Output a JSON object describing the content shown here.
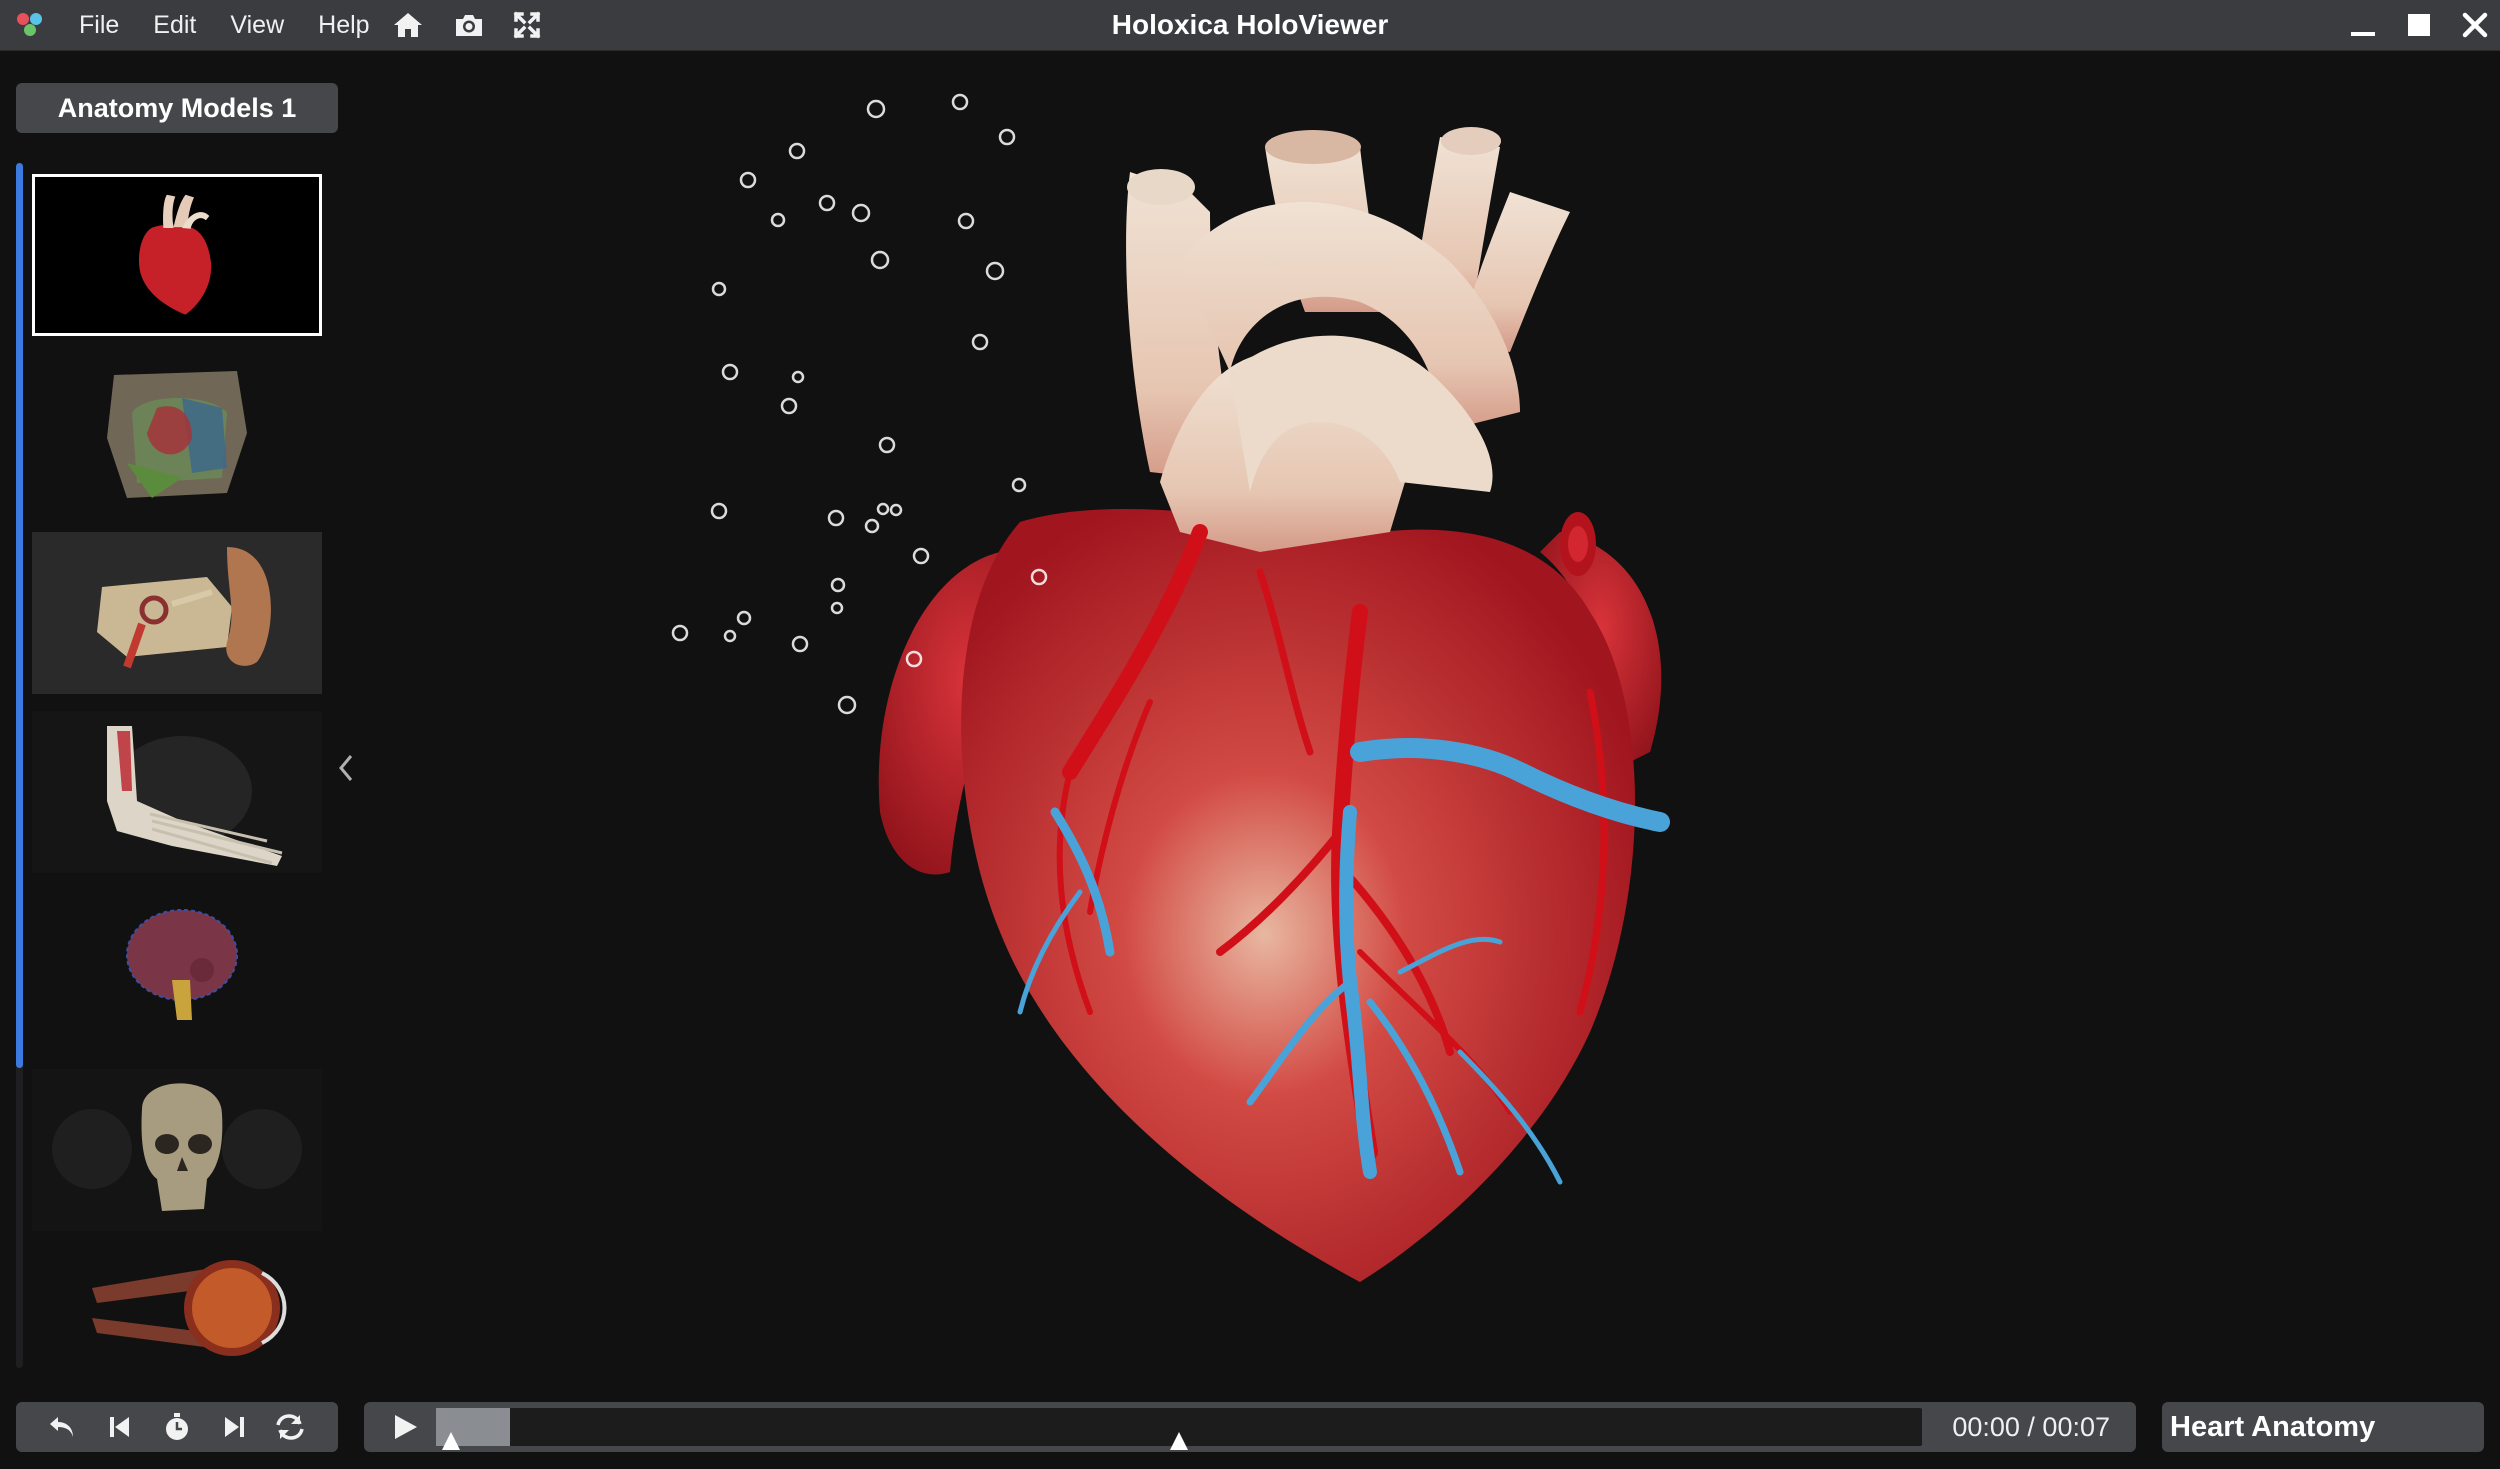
{
  "window": {
    "title": "Holoxica HoloViewer"
  },
  "menu": [
    {
      "label": "File"
    },
    {
      "label": "Edit"
    },
    {
      "label": "View"
    },
    {
      "label": "Help"
    }
  ],
  "toolbar_icons": [
    "home-icon",
    "camera-icon",
    "fullscreen-icon"
  ],
  "sidebar": {
    "collection_label": "Anatomy Models 1",
    "models": [
      {
        "icon": "heart-model-thumbnail",
        "selected": true
      },
      {
        "icon": "thorax-model-thumbnail",
        "selected": false
      },
      {
        "icon": "ear-model-thumbnail",
        "selected": false
      },
      {
        "icon": "foot-model-thumbnail",
        "selected": false
      },
      {
        "icon": "brain-model-thumbnail",
        "selected": false
      },
      {
        "icon": "skull-model-thumbnail",
        "selected": false
      },
      {
        "icon": "eye-model-thumbnail",
        "selected": false
      }
    ]
  },
  "controls": [
    "undo-icon",
    "skip-back-icon",
    "timer-icon",
    "skip-forward-icon",
    "refresh-icon"
  ],
  "player": {
    "time": "00:00 / 00:07",
    "progress": 0.05
  },
  "scene": {
    "title": "Heart Anatomy"
  },
  "colors": {
    "titlebar": "#3a3c3f",
    "panel": "#45474a",
    "background": "#111111",
    "scroll_accent": "#3b7be0",
    "heart_red": "#c8202a",
    "vessel_blue": "#4aa3d8"
  }
}
